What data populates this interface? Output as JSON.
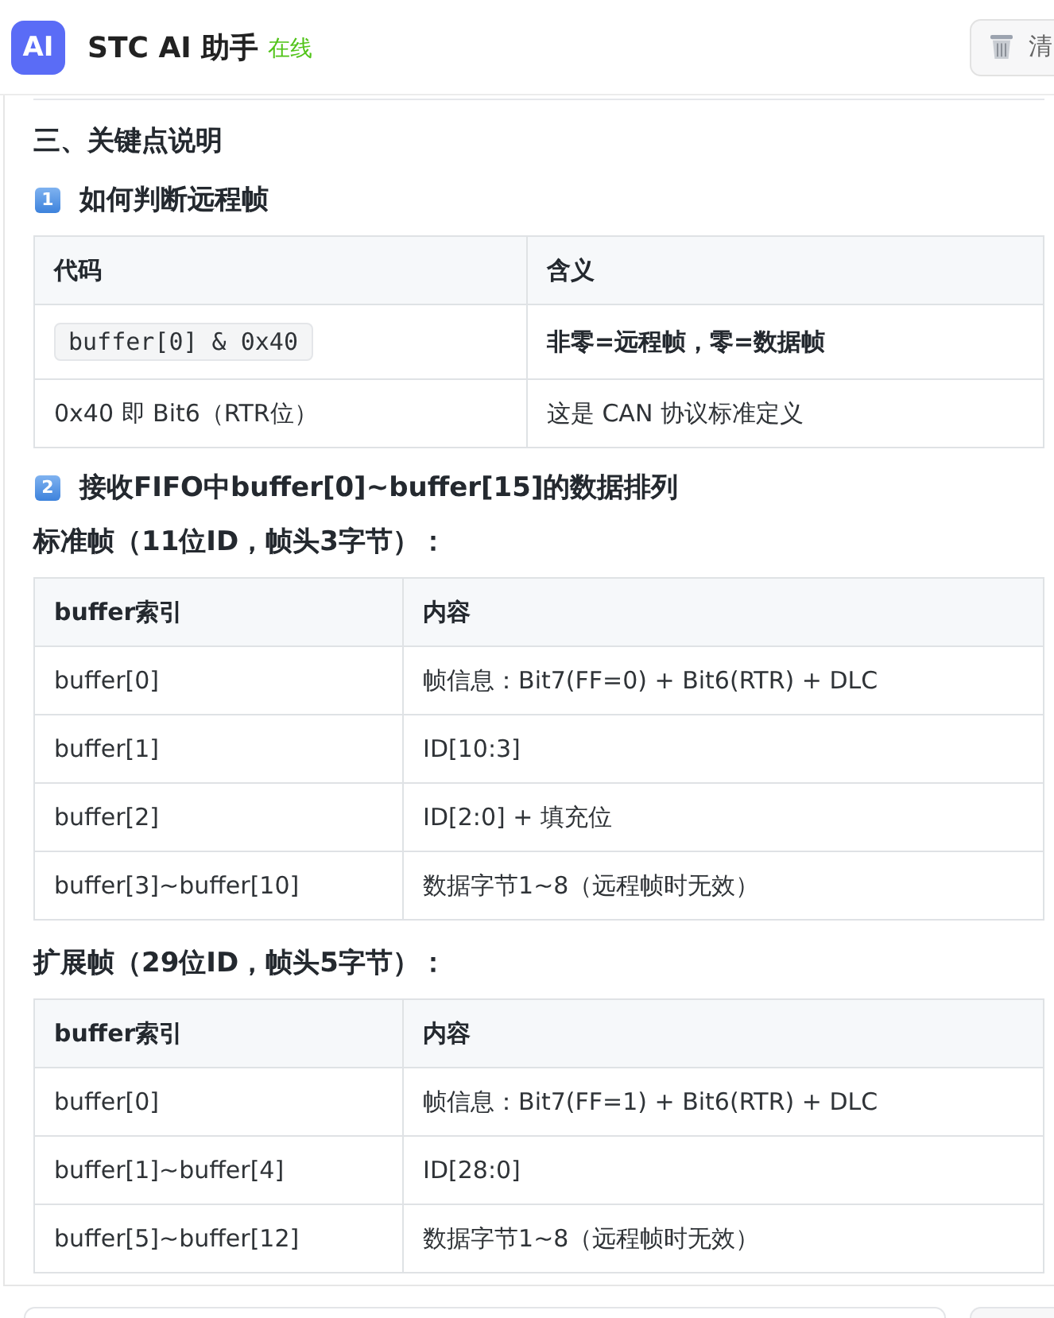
{
  "header": {
    "logo": "AI",
    "title": "STC AI 助手",
    "status": "在线",
    "clear_button": "清"
  },
  "message": {
    "blocks": [
      {
        "kind": "rule"
      },
      {
        "kind": "heading",
        "text": "三、关键点说明"
      },
      {
        "kind": "numbered_heading",
        "number": "1",
        "text": "如何判断远程帧"
      },
      {
        "kind": "table",
        "columns": [
          "代码",
          "含义"
        ],
        "rows": [
          [
            {
              "kind": "code",
              "text": "buffer[0] & 0x40"
            },
            {
              "kind": "bold",
              "text": "非零=远程帧，零=数据帧"
            }
          ],
          [
            {
              "kind": "plain",
              "text": "0x40 即 Bit6（RTR位）"
            },
            {
              "kind": "plain",
              "text": "这是 CAN 协议标准定义"
            }
          ]
        ]
      },
      {
        "kind": "numbered_heading",
        "number": "2",
        "text": "接收FIFO中buffer[0]~buffer[15]的数据排列"
      },
      {
        "kind": "bold_paragraph",
        "text": "标准帧（11位ID，帧头3字节）："
      },
      {
        "kind": "table",
        "columns": [
          "buffer索引",
          "内容"
        ],
        "rows": [
          [
            {
              "kind": "plain",
              "text": "buffer[0]"
            },
            {
              "kind": "plain",
              "text": "帧信息：Bit7(FF=0) + Bit6(RTR) + DLC"
            }
          ],
          [
            {
              "kind": "plain",
              "text": "buffer[1]"
            },
            {
              "kind": "plain",
              "text": "ID[10:3]"
            }
          ],
          [
            {
              "kind": "plain",
              "text": "buffer[2]"
            },
            {
              "kind": "plain",
              "text": "ID[2:0] + 填充位"
            }
          ],
          [
            {
              "kind": "plain",
              "text": "buffer[3]~buffer[10]"
            },
            {
              "kind": "plain",
              "text": "数据字节1~8（远程帧时无效）"
            }
          ]
        ]
      },
      {
        "kind": "bold_paragraph",
        "text": "扩展帧（29位ID，帧头5字节）："
      },
      {
        "kind": "table",
        "columns": [
          "buffer索引",
          "内容"
        ],
        "rows": [
          [
            {
              "kind": "plain",
              "text": "buffer[0]"
            },
            {
              "kind": "plain",
              "text": "帧信息：Bit7(FF=1) + Bit6(RTR) + DLC"
            }
          ],
          [
            {
              "kind": "plain",
              "text": "buffer[1]~buffer[4]"
            },
            {
              "kind": "plain",
              "text": "ID[28:0]"
            }
          ],
          [
            {
              "kind": "plain",
              "text": "buffer[5]~buffer[12]"
            },
            {
              "kind": "plain",
              "text": "数据字节1~8（远程帧时无效）"
            }
          ]
        ]
      }
    ]
  }
}
